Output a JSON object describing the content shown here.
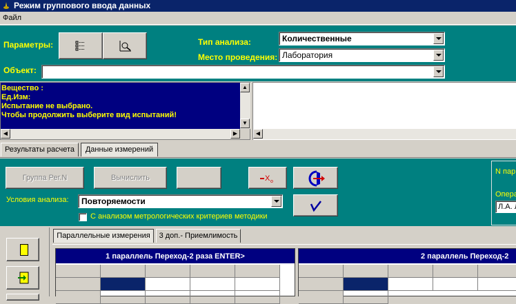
{
  "window": {
    "title": "Режим группового ввода данных"
  },
  "menu": {
    "file": "Файл"
  },
  "params": {
    "label_params": "Параметры:",
    "label_analysis_type": "Тип анализа:",
    "analysis_type_value": "Количественные",
    "label_location": "Место проведения:",
    "location_value": "Лаборатория",
    "label_object": "Объект:",
    "object_value": ""
  },
  "info": {
    "line1": "Вещество :",
    "line2": "Ед.Изм:",
    "line3": "Испытание не выбрано.",
    "line4": "Чтобы продолжить выберите вид испытаний!"
  },
  "main_tabs": {
    "results": "Результаты расчета",
    "measurements": "Данные измерений"
  },
  "toolbar": {
    "group_reg": "Группа Рег.N",
    "calculate": "Вычислить",
    "label_conditions": "Условия анализа:",
    "conditions_value": "Повторяемости",
    "metrology_checkbox": "С анализом метрологических критериев методики",
    "right_label_n": "N пар",
    "right_label_oper": "Опера",
    "right_value": "Л.А. Л"
  },
  "sub_tabs": {
    "parallel": "Параллельные измерения",
    "extra": "3 доп.- Приемлимость"
  },
  "grid": {
    "header1": "1 параллель Переход-2 раза ENTER>",
    "header2": "2 параллель Переход-2"
  },
  "colors": {
    "teal": "#008080",
    "navy": "#000080",
    "title": "#0a246a",
    "yellow": "#ffff00"
  }
}
